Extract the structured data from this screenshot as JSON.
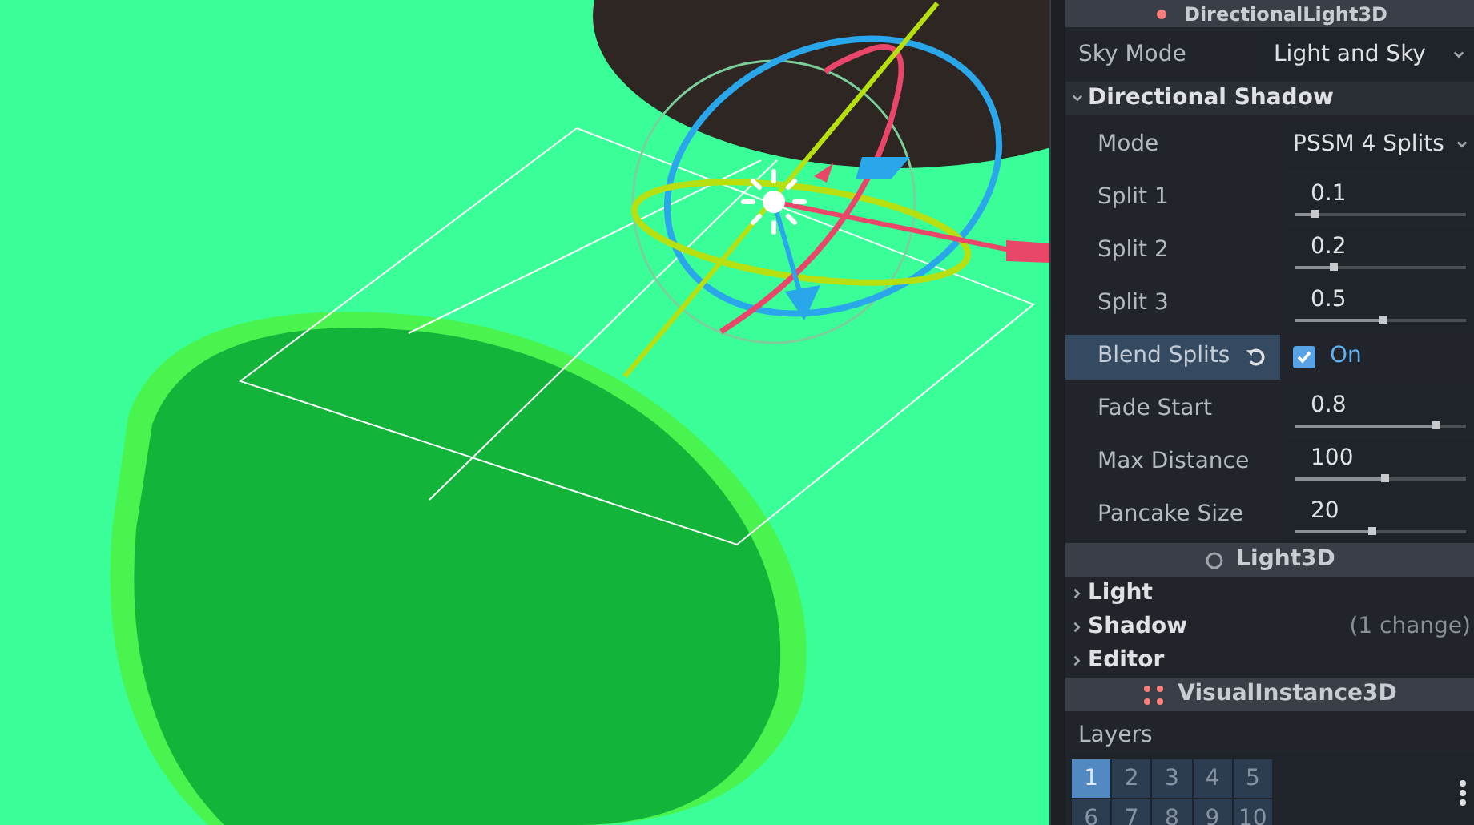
{
  "inspector": {
    "header": "DirectionalLight3D",
    "sky_mode": {
      "label": "Sky Mode",
      "value": "Light and Sky"
    },
    "section": {
      "title": "Directional Shadow",
      "expanded": true
    },
    "properties": [
      {
        "kind": "dropdown",
        "label": "Mode",
        "value": "PSSM 4 Splits",
        "selected": false
      },
      {
        "kind": "slider",
        "label": "Split 1",
        "value": "0.1",
        "level": 0.11,
        "selected": false
      },
      {
        "kind": "slider",
        "label": "Split 2",
        "value": "0.2",
        "level": 0.22,
        "selected": false
      },
      {
        "kind": "slider",
        "label": "Split 3",
        "value": "0.5",
        "level": 0.51,
        "selected": false
      },
      {
        "kind": "checkbox",
        "label": "Blend Splits",
        "value": "On",
        "checked": true,
        "selected": true
      },
      {
        "kind": "slider",
        "label": "Fade Start",
        "value": "0.8",
        "level": 0.82,
        "selected": false
      },
      {
        "kind": "slider",
        "label": "Max Distance",
        "value": "100",
        "level": 0.52,
        "selected": false
      },
      {
        "kind": "slider",
        "label": "Pancake Size",
        "value": "20",
        "level": 0.45,
        "selected": false
      }
    ],
    "class_header_1": "Light3D",
    "groups": [
      {
        "title": "Light",
        "expanded": false
      },
      {
        "title": "Shadow",
        "expanded": false,
        "note": "(1 change)"
      },
      {
        "title": "Editor",
        "expanded": false
      }
    ],
    "class_header_2": "VisualInstance3D",
    "layers": {
      "label": "Layers",
      "cells": [
        {
          "label": "1",
          "selected": true
        },
        {
          "label": "2",
          "selected": false
        },
        {
          "label": "3",
          "selected": false
        },
        {
          "label": "4",
          "selected": false
        },
        {
          "label": "5",
          "selected": false
        },
        {
          "label": "6",
          "selected": false
        },
        {
          "label": "7",
          "selected": false
        },
        {
          "label": "8",
          "selected": false
        },
        {
          "label": "9",
          "selected": false
        },
        {
          "label": "10",
          "selected": false
        }
      ]
    }
  }
}
